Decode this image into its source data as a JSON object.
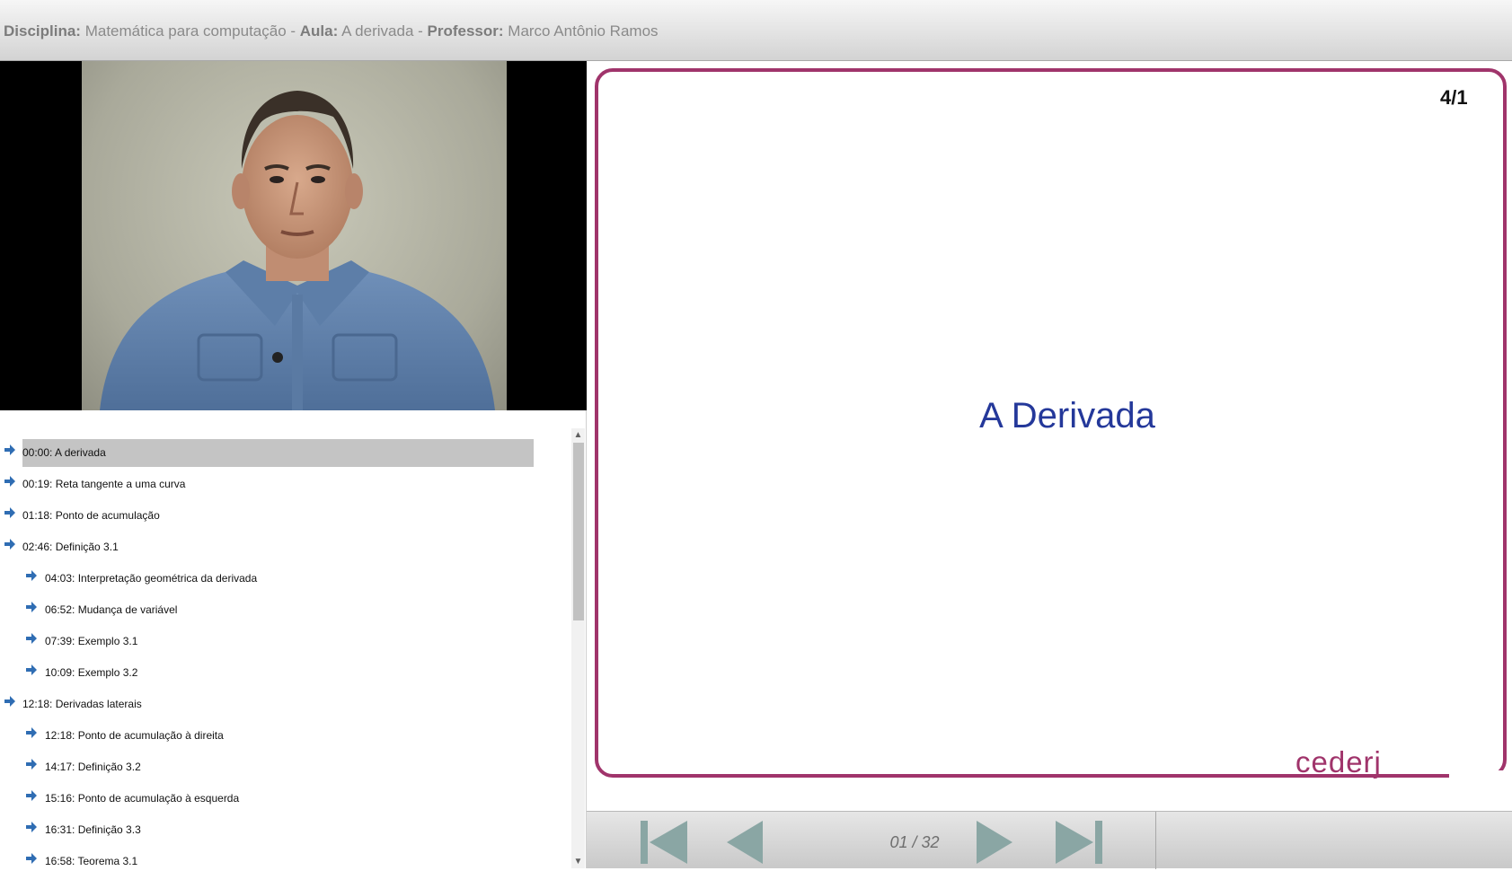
{
  "header": {
    "discipline_label": "Disciplina:",
    "discipline_value": "Matemática para computação",
    "separator_1": " - ",
    "lesson_label": "Aula:",
    "lesson_value": "A derivada",
    "separator_2": " - ",
    "professor_label": "Professor:",
    "professor_value": "Marco Antônio Ramos"
  },
  "chapters": [
    {
      "label": "00:00: A derivada",
      "level": 0,
      "selected": true
    },
    {
      "label": "00:19: Reta tangente a uma curva",
      "level": 0,
      "selected": false
    },
    {
      "label": "01:18: Ponto de acumulação",
      "level": 0,
      "selected": false
    },
    {
      "label": "02:46: Definição 3.1",
      "level": 0,
      "selected": false
    },
    {
      "label": "04:03: Interpretação geométrica da derivada",
      "level": 1,
      "selected": false
    },
    {
      "label": "06:52: Mudança de variável",
      "level": 1,
      "selected": false
    },
    {
      "label": "07:39: Exemplo 3.1",
      "level": 1,
      "selected": false
    },
    {
      "label": "10:09: Exemplo 3.2",
      "level": 1,
      "selected": false
    },
    {
      "label": "12:18: Derivadas laterais",
      "level": 0,
      "selected": false
    },
    {
      "label": "12:18: Ponto de acumulação à direita",
      "level": 1,
      "selected": false
    },
    {
      "label": "14:17: Definição 3.2",
      "level": 1,
      "selected": false
    },
    {
      "label": "15:16: Ponto de acumulação à esquerda",
      "level": 1,
      "selected": false
    },
    {
      "label": "16:31: Definição 3.3",
      "level": 1,
      "selected": false
    },
    {
      "label": "16:58: Teorema 3.1",
      "level": 1,
      "selected": false
    }
  ],
  "slide": {
    "number": "4/1",
    "title": "A Derivada",
    "logo": "cederj",
    "border_color": "#a0346b",
    "title_color": "#24389a"
  },
  "controls": {
    "page_indicator": "01 / 32",
    "icon_color": "#8aa6a4",
    "first_icon": "skip-to-first-icon",
    "prev_icon": "previous-icon",
    "next_icon": "next-icon",
    "last_icon": "skip-to-last-icon"
  },
  "colors": {
    "arrow": "#2f6db3",
    "selected_row": "#c4c4c4"
  }
}
